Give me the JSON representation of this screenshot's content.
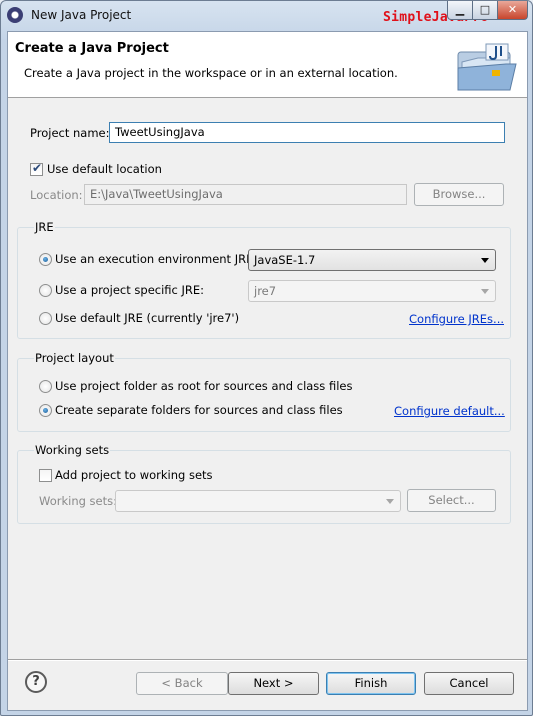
{
  "window": {
    "title": "New Java Project",
    "watermark": "SimpleJavaPro",
    "controls": {
      "minimize": "▁",
      "maximize": "□",
      "close": "✕"
    }
  },
  "header": {
    "title": "Create a Java Project",
    "description": "Create a Java project in the workspace or in an external location.",
    "graphic_icon": "java-project-folder-icon"
  },
  "project_name": {
    "label": "Project name:",
    "value": "TweetUsingJava"
  },
  "location": {
    "use_default_label": "Use default location",
    "use_default_checked": true,
    "label": "Location:",
    "value": "E:\\Java\\TweetUsingJava",
    "browse_label": "Browse..."
  },
  "jre": {
    "group_title": "JRE",
    "options": [
      {
        "label": "Use an execution environment JRE:",
        "selected": true
      },
      {
        "label": "Use a project specific JRE:",
        "selected": false
      },
      {
        "label": "Use default JRE (currently 'jre7')",
        "selected": false
      }
    ],
    "execution_env_value": "JavaSE-1.7",
    "project_specific_value": "jre7",
    "configure_link": "Configure JREs..."
  },
  "project_layout": {
    "group_title": "Project layout",
    "options": [
      {
        "label": "Use project folder as root for sources and class files",
        "selected": false
      },
      {
        "label": "Create separate folders for sources and class files",
        "selected": true
      }
    ],
    "configure_link": "Configure default..."
  },
  "working_sets": {
    "group_title": "Working sets",
    "add_label": "Add project to working sets",
    "add_checked": false,
    "label": "Working sets:",
    "value": "",
    "select_label": "Select..."
  },
  "footer": {
    "help_icon": "help-icon",
    "help_glyph": "?",
    "back_label": "< Back",
    "next_label": "Next >",
    "finish_label": "Finish",
    "cancel_label": "Cancel"
  },
  "colors": {
    "link": "#0033cc",
    "watermark": "#e0101a",
    "header_bg": "#ffffff",
    "dialog_bg": "#f0f0f0"
  }
}
